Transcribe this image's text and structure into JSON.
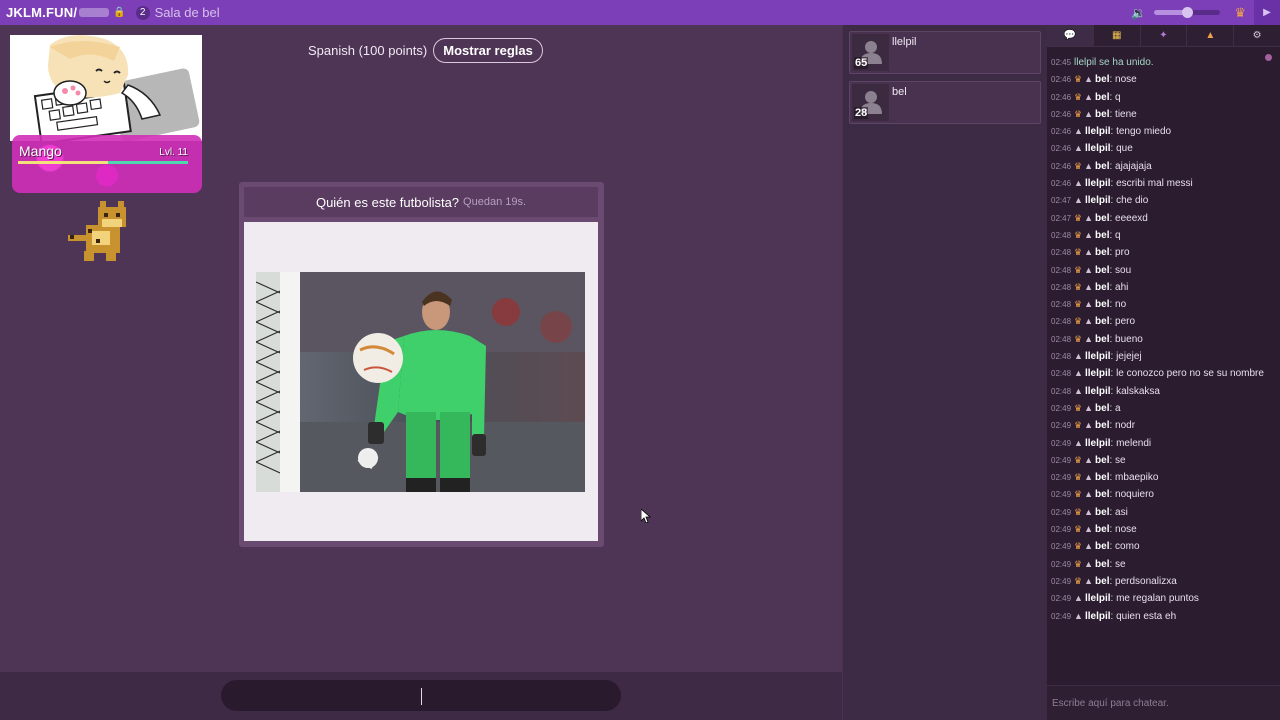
{
  "topbar": {
    "site": "JKLM.FUN/",
    "player_count": "2",
    "room_name": "Sala de bel",
    "volume_level": 0.5
  },
  "game": {
    "language_points": "Spanish (100 points)",
    "rules_button": "Mostrar reglas",
    "question": "Quién es este futbolista?",
    "timer": "Quedan 19s.",
    "answer_value": ""
  },
  "profile": {
    "name": "Mango",
    "level": "Lvl. 11"
  },
  "players": [
    {
      "name": "llelpil",
      "points": "65"
    },
    {
      "name": "bel",
      "points": "28"
    }
  ],
  "chat": {
    "input_placeholder": "Escribe aquí para chatear.",
    "tabs": [
      "chat-icon",
      "trophy-icon",
      "star-icon",
      "kick-icon",
      "settings-icon"
    ],
    "messages": [
      {
        "time": "02:45",
        "crown": false,
        "user": "",
        "text": "llelpil se ha unido.",
        "system": true
      },
      {
        "time": "02:46",
        "crown": true,
        "user": "bel",
        "text": "nose"
      },
      {
        "time": "02:46",
        "crown": true,
        "user": "bel",
        "text": "q"
      },
      {
        "time": "02:46",
        "crown": true,
        "user": "bel",
        "text": "tiene"
      },
      {
        "time": "02:46",
        "crown": false,
        "user": "llelpil",
        "text": "tengo miedo"
      },
      {
        "time": "02:46",
        "crown": false,
        "user": "llelpil",
        "text": "que"
      },
      {
        "time": "02:46",
        "crown": true,
        "user": "bel",
        "text": "ajajajaja"
      },
      {
        "time": "02:46",
        "crown": false,
        "user": "llelpil",
        "text": "escribi mal messi"
      },
      {
        "time": "02:47",
        "crown": false,
        "user": "llelpil",
        "text": "che dio"
      },
      {
        "time": "02:47",
        "crown": true,
        "user": "bel",
        "text": "eeeexd"
      },
      {
        "time": "02:48",
        "crown": true,
        "user": "bel",
        "text": "q"
      },
      {
        "time": "02:48",
        "crown": true,
        "user": "bel",
        "text": "pro"
      },
      {
        "time": "02:48",
        "crown": true,
        "user": "bel",
        "text": "sou"
      },
      {
        "time": "02:48",
        "crown": true,
        "user": "bel",
        "text": "ahi"
      },
      {
        "time": "02:48",
        "crown": true,
        "user": "bel",
        "text": "no"
      },
      {
        "time": "02:48",
        "crown": true,
        "user": "bel",
        "text": "pero"
      },
      {
        "time": "02:48",
        "crown": true,
        "user": "bel",
        "text": "bueno"
      },
      {
        "time": "02:48",
        "crown": false,
        "user": "llelpil",
        "text": "jejejej"
      },
      {
        "time": "02:48",
        "crown": false,
        "user": "llelpil",
        "text": "le conozco pero no se su nombre"
      },
      {
        "time": "02:48",
        "crown": false,
        "user": "llelpil",
        "text": "kalskaksa"
      },
      {
        "time": "02:49",
        "crown": true,
        "user": "bel",
        "text": "a"
      },
      {
        "time": "02:49",
        "crown": true,
        "user": "bel",
        "text": "nodr"
      },
      {
        "time": "02:49",
        "crown": false,
        "user": "llelpil",
        "text": "melendi"
      },
      {
        "time": "02:49",
        "crown": true,
        "user": "bel",
        "text": "se"
      },
      {
        "time": "02:49",
        "crown": true,
        "user": "bel",
        "text": "mbaepiko"
      },
      {
        "time": "02:49",
        "crown": true,
        "user": "bel",
        "text": "noquiero"
      },
      {
        "time": "02:49",
        "crown": true,
        "user": "bel",
        "text": "asi"
      },
      {
        "time": "02:49",
        "crown": true,
        "user": "bel",
        "text": "nose"
      },
      {
        "time": "02:49",
        "crown": true,
        "user": "bel",
        "text": "como"
      },
      {
        "time": "02:49",
        "crown": true,
        "user": "bel",
        "text": "se"
      },
      {
        "time": "02:49",
        "crown": true,
        "user": "bel",
        "text": "perdsonalizxa"
      },
      {
        "time": "02:49",
        "crown": false,
        "user": "llelpil",
        "text": "me regalan puntos"
      },
      {
        "time": "02:49",
        "crown": false,
        "user": "llelpil",
        "text": "quien esta eh"
      }
    ]
  },
  "colors": {
    "topbar": "#7d3fb8",
    "main_bg": "#4e3455",
    "chat_bg": "#2b1c30",
    "crown": "#f0a24a"
  }
}
